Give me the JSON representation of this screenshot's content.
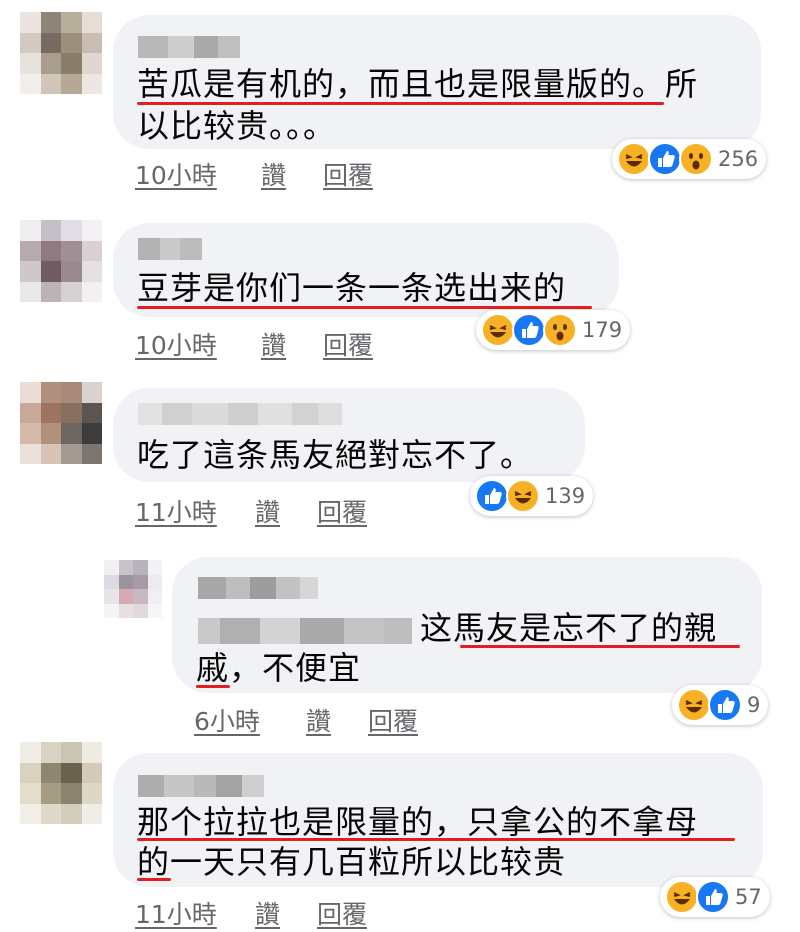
{
  "comments": [
    {
      "text_lines": [
        "苦瓜是有机的，而且也是限量版的。所",
        "以比较贵。。。"
      ],
      "time": "10小時",
      "like_label": "讚",
      "reply_label": "回覆",
      "reactions": [
        "haha-icon",
        "like-icon",
        "wow-icon"
      ],
      "count": "256"
    },
    {
      "text_lines": [
        "豆芽是你们一条一条选出来的"
      ],
      "time": "10小時",
      "like_label": "讚",
      "reply_label": "回覆",
      "reactions": [
        "haha-icon",
        "like-icon",
        "wow-icon"
      ],
      "count": "179"
    },
    {
      "text_lines": [
        "吃了這条馬友絕對忘不了。"
      ],
      "time": "11小時",
      "like_label": "讚",
      "reply_label": "回覆",
      "reactions": [
        "like-icon",
        "haha-icon"
      ],
      "count": "139"
    },
    {
      "text_lines": [
        "这馬友是忘不了的親",
        "戚，不便宜"
      ],
      "time": "6小時",
      "like_label": "讚",
      "reply_label": "回覆",
      "reactions": [
        "haha-icon",
        "like-icon"
      ],
      "count": "9"
    },
    {
      "text_lines": [
        "那个拉拉也是限量的，只拿公的不拿母",
        "的一天只有几百粒所以比较贵"
      ],
      "time": "11小時",
      "like_label": "讚",
      "reply_label": "回覆",
      "reactions": [
        "haha-icon",
        "like-icon"
      ],
      "count": "57"
    }
  ],
  "colors": {
    "bubble": "#f0f2f5",
    "underline": "#e02020",
    "meta": "#65676b",
    "like": "#1877f2",
    "haha": "#f7b125"
  }
}
